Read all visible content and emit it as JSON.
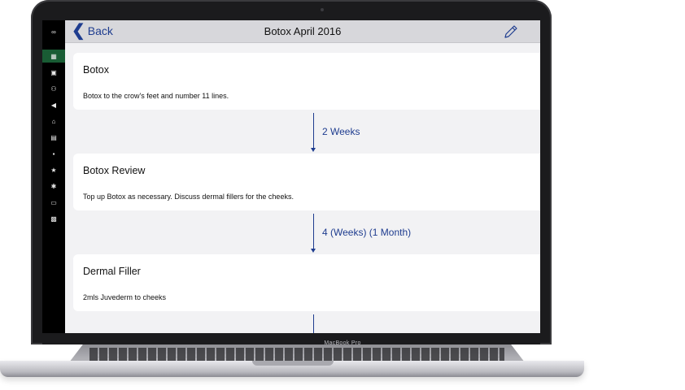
{
  "device": {
    "model_label": "MacBook Pro"
  },
  "sidebar": {
    "items": [
      {
        "icon": "infinity-icon",
        "glyph": "∞",
        "active": false
      },
      {
        "icon": "calendar-icon",
        "glyph": "▦",
        "active": true
      },
      {
        "icon": "date-icon",
        "glyph": "▣",
        "active": false
      },
      {
        "icon": "people-icon",
        "glyph": "⚇",
        "active": false
      },
      {
        "icon": "megaphone-icon",
        "glyph": "◀",
        "active": false
      },
      {
        "icon": "basket-icon",
        "glyph": "⌂",
        "active": false
      },
      {
        "icon": "list-icon",
        "glyph": "▤",
        "active": false
      },
      {
        "icon": "contact-icon",
        "glyph": "▪",
        "active": false
      },
      {
        "icon": "star-icon",
        "glyph": "★",
        "active": false
      },
      {
        "icon": "gear-icon",
        "glyph": "✱",
        "active": false
      },
      {
        "icon": "card-icon",
        "glyph": "▭",
        "active": false
      },
      {
        "icon": "box-icon",
        "glyph": "▩",
        "active": false
      }
    ]
  },
  "navbar": {
    "back_label": "Back",
    "title": "Botox April 2016",
    "edit_icon": "pencil-icon"
  },
  "plan": {
    "steps": [
      {
        "title": "Botox",
        "description": "Botox to the crow's feet and number 11 lines."
      },
      {
        "interval": "2 Weeks"
      },
      {
        "title": "Botox Review",
        "description": "Top up Botox as necessary. Discuss dermal fillers for the cheeks."
      },
      {
        "interval": "4 (Weeks) (1 Month)"
      },
      {
        "title": "Dermal Filler",
        "description": "2mls Juvederm to cheeks"
      }
    ]
  },
  "colors": {
    "accent_blue": "#1e3c8f",
    "sidebar_active": "#195c34"
  }
}
